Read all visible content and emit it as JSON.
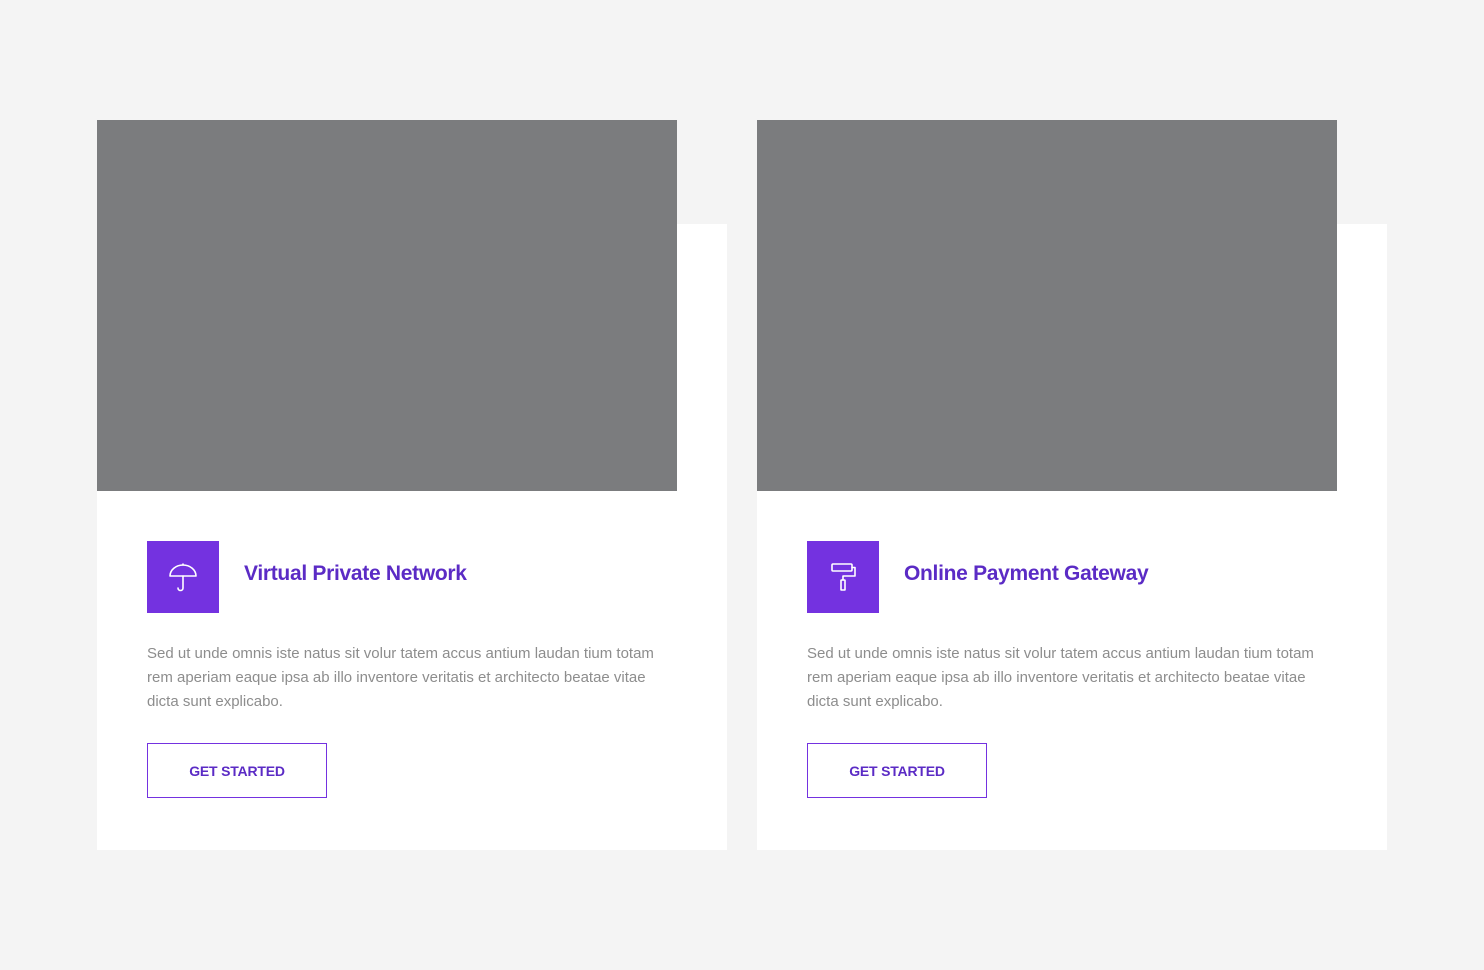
{
  "cards": [
    {
      "title": "Virtual Private Network",
      "icon": "umbrella-icon",
      "description": "Sed ut unde omnis iste natus sit volur tatem accus antium laudan tium totam rem aperiam eaque ipsa ab illo inventore veritatis et architecto beatae vitae dicta sunt explicabo.",
      "button_label": "GET STARTED"
    },
    {
      "title": "Online Payment Gateway",
      "icon": "paint-roller-icon",
      "description": "Sed ut unde omnis iste natus sit volur tatem accus antium laudan tium totam rem aperiam eaque ipsa ab illo inventore veritatis et architecto beatae vitae dicta sunt explicabo.",
      "button_label": "GET STARTED"
    }
  ],
  "colors": {
    "accent": "#7432e0",
    "title": "#5b2bc5",
    "body_text": "#8d8d8d",
    "image_placeholder": "#7b7c7e",
    "page_background": "#f4f4f4",
    "card_background": "#ffffff"
  }
}
